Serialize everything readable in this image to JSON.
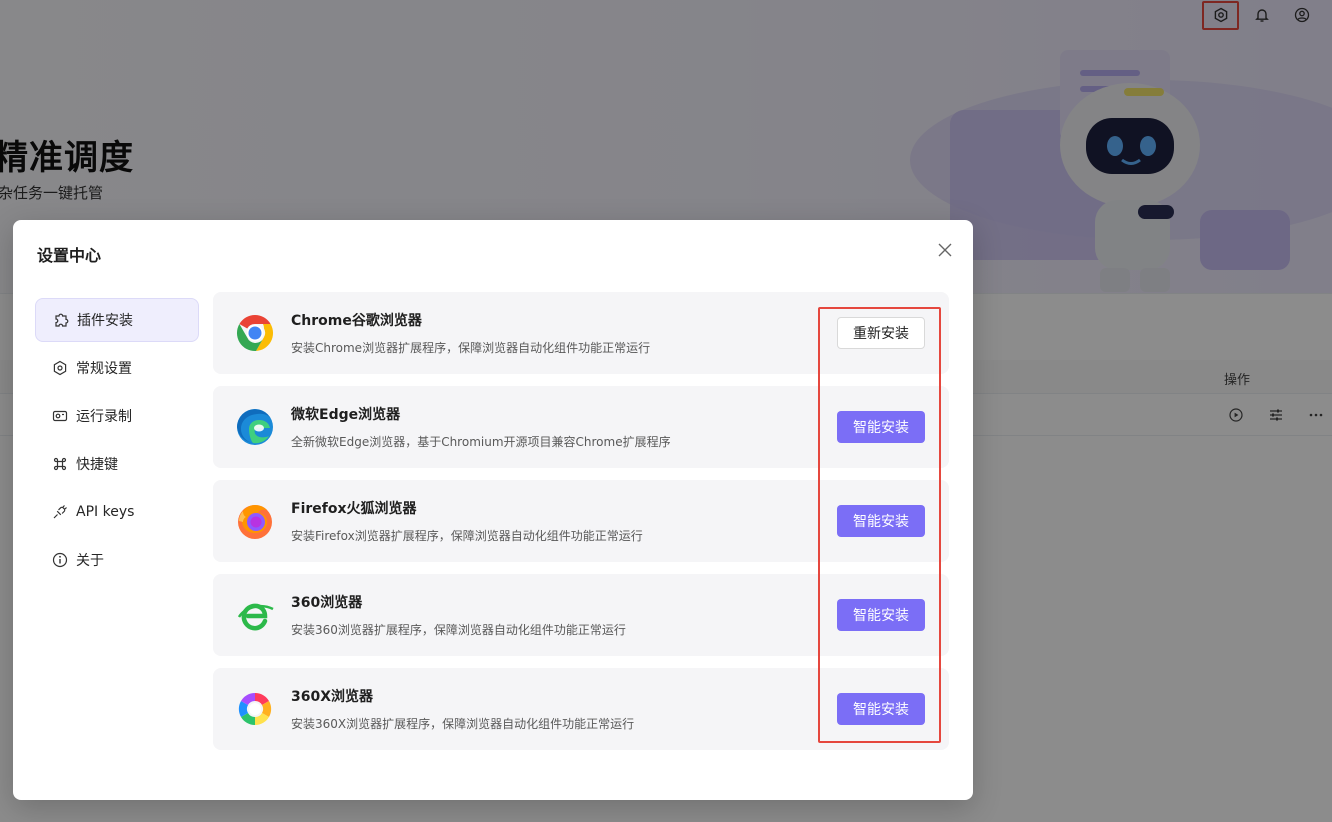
{
  "background": {
    "hero_title": "精准调度",
    "hero_subtitle": "杂任务一键托管",
    "table_header_actions": "操作",
    "topbar_icons": [
      "settings-icon",
      "bell-icon",
      "user-icon"
    ],
    "row_icons": [
      "play-icon",
      "sliders-icon",
      "more-icon"
    ]
  },
  "modal": {
    "title": "设置中心",
    "nav": [
      {
        "label": "插件安装",
        "icon": "puzzle-icon",
        "active": true
      },
      {
        "label": "常规设置",
        "icon": "gear-icon",
        "active": false
      },
      {
        "label": "运行录制",
        "icon": "record-icon",
        "active": false
      },
      {
        "label": "快捷键",
        "icon": "command-icon",
        "active": false
      },
      {
        "label": "API keys",
        "icon": "key-plug-icon",
        "active": false
      },
      {
        "label": "关于",
        "icon": "info-icon",
        "active": false
      }
    ],
    "plugins": [
      {
        "name": "Chrome谷歌浏览器",
        "desc": "安装Chrome浏览器扩展程序，保障浏览器自动化组件功能正常运行",
        "button": "重新安装",
        "icon": "chrome-icon"
      },
      {
        "name": "微软Edge浏览器",
        "desc": "全新微软Edge浏览器，基于Chromium开源项目兼容Chrome扩展程序",
        "button": "智能安装",
        "icon": "edge-icon"
      },
      {
        "name": "Firefox火狐浏览器",
        "desc": "安装Firefox浏览器扩展程序，保障浏览器自动化组件功能正常运行",
        "button": "智能安装",
        "icon": "firefox-icon"
      },
      {
        "name": "360浏览器",
        "desc": "安装360浏览器扩展程序，保障浏览器自动化组件功能正常运行",
        "button": "智能安装",
        "icon": "360-browser-icon"
      },
      {
        "name": "360X浏览器",
        "desc": "安装360X浏览器扩展程序，保障浏览器自动化组件功能正常运行",
        "button": "智能安装",
        "icon": "360x-browser-icon"
      }
    ]
  },
  "colors": {
    "accent": "#7b6ef6",
    "highlight": "#e5473e",
    "card_bg": "#f5f5f7"
  }
}
